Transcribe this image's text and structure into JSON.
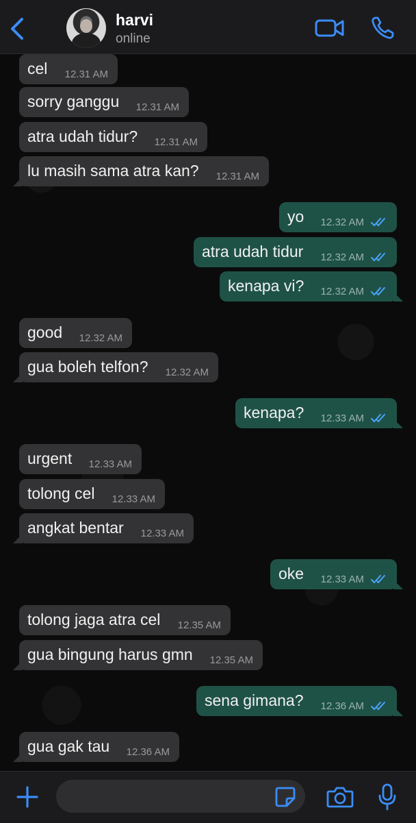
{
  "header": {
    "contact_name": "harvi",
    "status": "online",
    "icons": {
      "back": "chevron-left-icon",
      "video": "video-camera-icon",
      "call": "phone-icon",
      "avatar": "contact-avatar"
    }
  },
  "colors": {
    "accent": "#3b8df6",
    "incoming_bubble": "#333335",
    "outgoing_bubble": "#1f5247",
    "read_ticks": "#4aa3ff"
  },
  "messages": [
    {
      "dir": "in",
      "text": "cel",
      "time": "12.31 AM"
    },
    {
      "dir": "in",
      "text": "sorry ganggu",
      "time": "12.31 AM"
    },
    {
      "dir": "in",
      "text": "atra udah tidur?",
      "time": "12.31 AM"
    },
    {
      "dir": "in",
      "text": "lu masih sama atra kan?",
      "time": "12.31 AM"
    },
    {
      "dir": "out",
      "text": "yo",
      "time": "12.32 AM",
      "read": true
    },
    {
      "dir": "out",
      "text": "atra udah tidur",
      "time": "12.32 AM",
      "read": true
    },
    {
      "dir": "out",
      "text": "kenapa vi?",
      "time": "12.32 AM",
      "read": true
    },
    {
      "dir": "in",
      "text": "good",
      "time": "12.32 AM"
    },
    {
      "dir": "in",
      "text": "gua boleh telfon?",
      "time": "12.32 AM"
    },
    {
      "dir": "out",
      "text": "kenapa?",
      "time": "12.33 AM",
      "read": true
    },
    {
      "dir": "in",
      "text": "urgent",
      "time": "12.33 AM"
    },
    {
      "dir": "in",
      "text": "tolong cel",
      "time": "12.33 AM"
    },
    {
      "dir": "in",
      "text": "angkat bentar",
      "time": "12.33 AM"
    },
    {
      "dir": "out",
      "text": "oke",
      "time": "12.33 AM",
      "read": true
    },
    {
      "dir": "in",
      "text": "tolong jaga atra cel",
      "time": "12.35 AM"
    },
    {
      "dir": "in",
      "text": "gua bingung harus gmn",
      "time": "12.35 AM"
    },
    {
      "dir": "out",
      "text": "sena gimana?",
      "time": "12.36 AM",
      "read": true
    },
    {
      "dir": "in",
      "text": "gua gak tau",
      "time": "12.36 AM"
    }
  ],
  "composer": {
    "placeholder": "",
    "value": "",
    "icons": {
      "plus": "plus-icon",
      "sticker": "sticker-icon",
      "camera": "camera-icon",
      "mic": "microphone-icon"
    }
  }
}
